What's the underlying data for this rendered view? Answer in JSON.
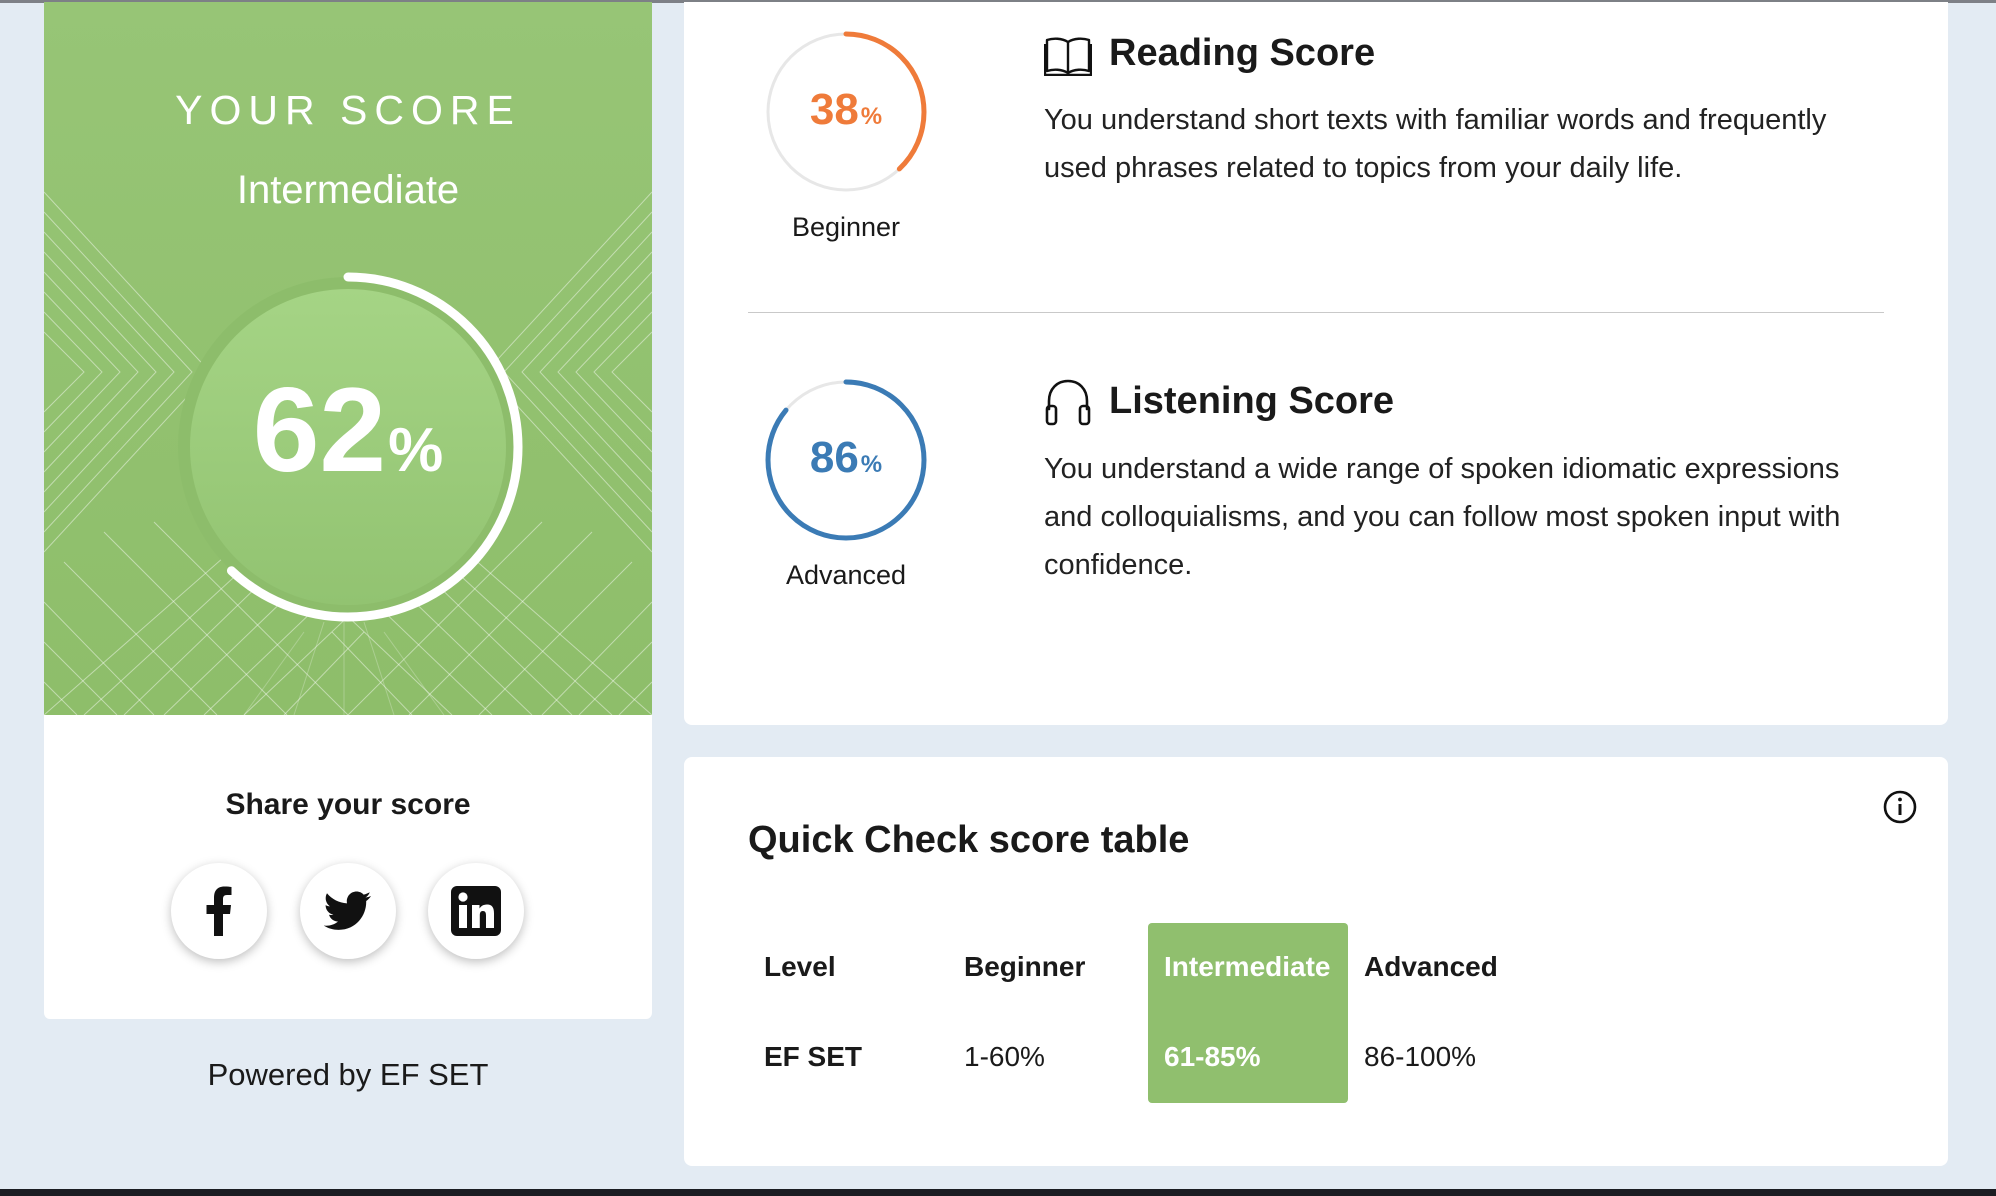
{
  "overall": {
    "heading": "YOUR SCORE",
    "level": "Intermediate",
    "value": "62",
    "unit": "%",
    "percent": 62,
    "color": "#97c576"
  },
  "share": {
    "title": "Share your score",
    "networks": [
      {
        "name": "Facebook",
        "icon": "facebook-icon"
      },
      {
        "name": "Twitter",
        "icon": "twitter-icon"
      },
      {
        "name": "LinkedIn",
        "icon": "linkedin-icon"
      }
    ]
  },
  "powered_by": "Powered by EF SET",
  "reading": {
    "title": "Reading Score",
    "icon": "book-icon",
    "value": "38",
    "unit": "%",
    "percent": 38,
    "level": "Beginner",
    "color": "#ef7b3a",
    "description": "You understand short texts with familiar words and frequently used phrases related to topics from your daily life."
  },
  "listening": {
    "title": "Listening Score",
    "icon": "headphones-icon",
    "value": "86",
    "unit": "%",
    "percent": 86,
    "level": "Advanced",
    "color": "#3b7bb5",
    "description": "You understand a wide range of spoken idiomatic expressions and colloquialisms, and you can follow most spoken input with confidence."
  },
  "score_table": {
    "title": "Quick Check score table",
    "info_icon": "info-icon",
    "header": [
      "Level",
      "Beginner",
      "Intermediate",
      "Advanced"
    ],
    "row": [
      "EF SET",
      "1-60%",
      "61-85%",
      "86-100%"
    ],
    "highlight_column": 2,
    "highlight_color": "#90bf6e"
  }
}
